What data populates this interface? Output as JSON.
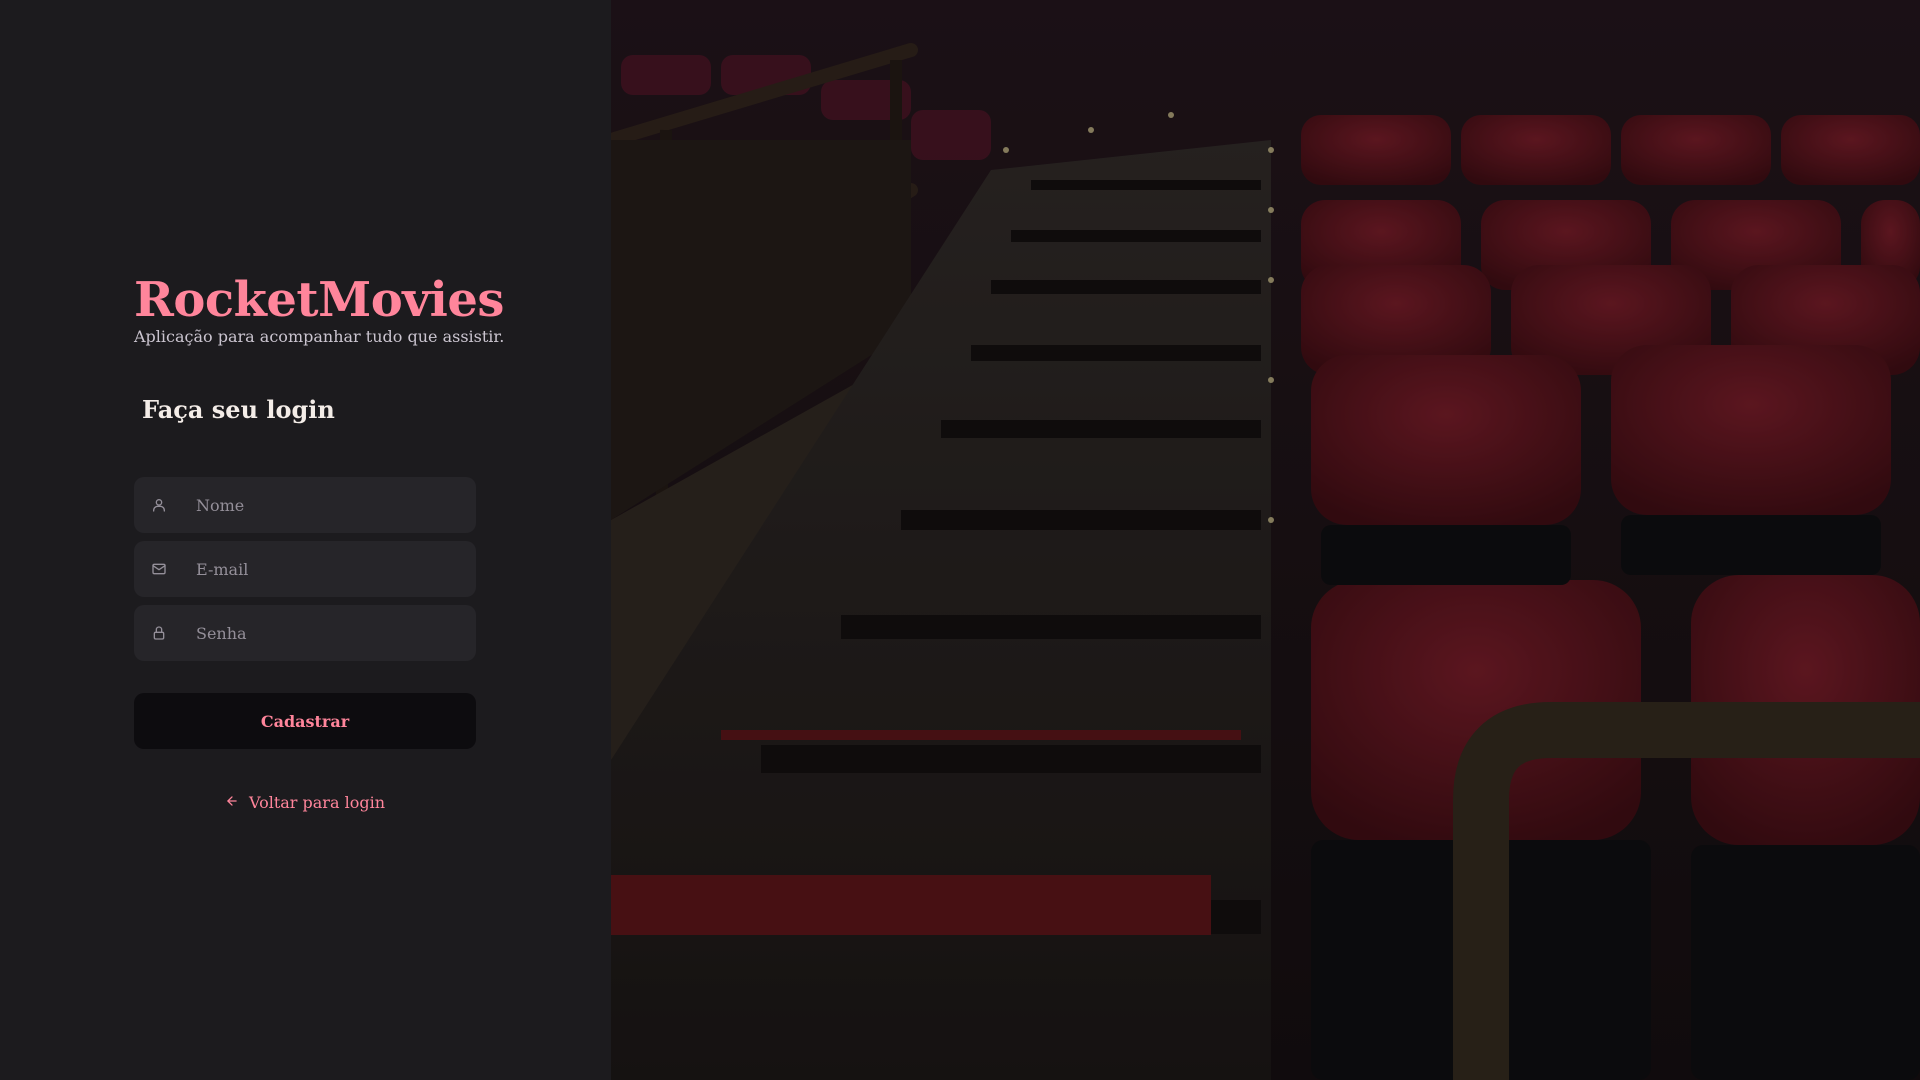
{
  "brand": {
    "title": "RocketMovies",
    "subtitle": "Aplicação para acompanhar tudo que assistir."
  },
  "form": {
    "heading": "Faça seu login",
    "fields": {
      "name": {
        "placeholder": "Nome",
        "icon": "user-icon"
      },
      "email": {
        "placeholder": "E-mail",
        "icon": "mail-icon"
      },
      "password": {
        "placeholder": "Senha",
        "icon": "lock-icon"
      }
    },
    "submit_label": "Cadastrar",
    "back_link_label": "Voltar para login",
    "back_link_icon": "arrow-left-icon"
  },
  "background": {
    "image": "cinema-seats-photo"
  },
  "colors": {
    "accent": "#ff859b",
    "panel": "#1c1b1e",
    "input": "#262529",
    "button": "#0d0c0f"
  }
}
